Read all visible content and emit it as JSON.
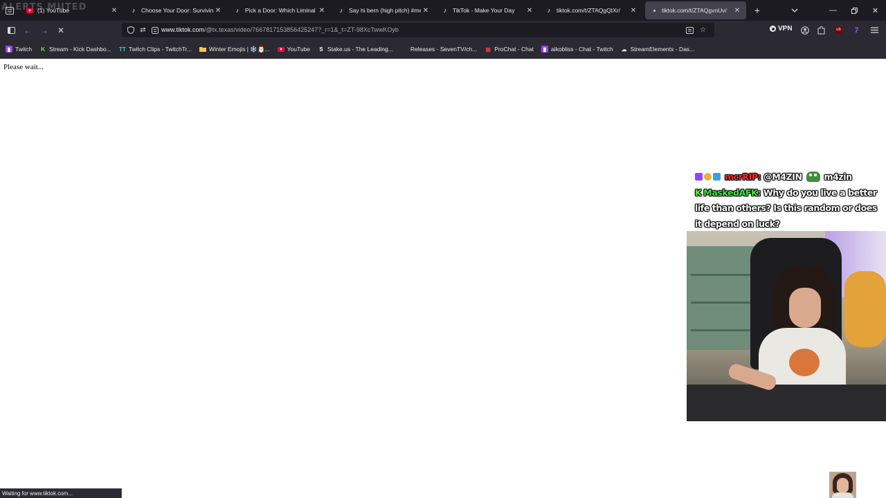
{
  "overlay": {
    "alerts_label": "ALERTS MUTED"
  },
  "tabs": [
    {
      "title": "(1) YouTube",
      "favicon": "youtube-icon",
      "active": false
    },
    {
      "title": "Choose Your Door: Surviving M",
      "favicon": "tiktok-icon",
      "active": false
    },
    {
      "title": "Pick a Door: Which Liminal Wor",
      "favicon": "tiktok-icon",
      "active": false
    },
    {
      "title": "Say hi bern (high pitch) #meme",
      "favicon": "tiktok-icon",
      "active": false
    },
    {
      "title": "TikTok - Make Your Day",
      "favicon": "tiktok-icon",
      "active": false
    },
    {
      "title": "tiktok.com/t/ZTAQgQtXr/",
      "favicon": "tiktok-icon",
      "active": false
    },
    {
      "title": "tiktok.com/t/ZTAQgvnUv/",
      "favicon": "loading-dot-icon",
      "active": true
    }
  ],
  "urlbar": {
    "host": "www.tiktok.com",
    "path": "/@tx.texas/video/7667817153856425247?_r=1&_t=ZT-98XcTwwKOyb"
  },
  "toolbar": {
    "vpn_label": "VPN"
  },
  "bookmarks": [
    {
      "label": "Twitch",
      "icon": "twitch-icon",
      "color": "#9146ff"
    },
    {
      "label": "Stream - Kick Dashbo...",
      "icon": "kick-icon",
      "color": "#53fc18"
    },
    {
      "label": "Twitch Clips - TwitchTr...",
      "icon": "twitchtracker-icon",
      "color": "#2fd6c9"
    },
    {
      "label": "Winter Emojis | ❄️🎅...",
      "icon": "folder-icon",
      "color": "#f5c451"
    },
    {
      "label": "YouTube",
      "icon": "youtube-icon",
      "color": "#ff0033"
    },
    {
      "label": "Stake.us - The Leading...",
      "icon": "stake-icon",
      "color": "#ffffff"
    },
    {
      "label": "Releases · SevenTV/ch...",
      "icon": "blank-icon",
      "color": "#2b2a33"
    },
    {
      "label": "ProChat - Chat",
      "icon": "prochat-icon",
      "color": "#e23b3b"
    },
    {
      "label": "aikobliss - Chat - Twitch",
      "icon": "twitch-icon",
      "color": "#9146ff"
    },
    {
      "label": "StreamElements - Das...",
      "icon": "streamelements-icon",
      "color": "#d7d7e0"
    }
  ],
  "page": {
    "message": "Please wait..."
  },
  "chat": [
    {
      "platform": "twitch",
      "user": "mcrRIP:",
      "user_color": "#ff2a2a",
      "message": "@M4ZIN",
      "trailing": "m4zin"
    },
    {
      "platform": "kick",
      "user": "MaskedAFK:",
      "user_color": "#3ee83e",
      "message": "Why do you live a better life than others? Is this random or does it depend on luck?"
    }
  ],
  "status": {
    "text": "Waiting for www.tiktok.com..."
  }
}
